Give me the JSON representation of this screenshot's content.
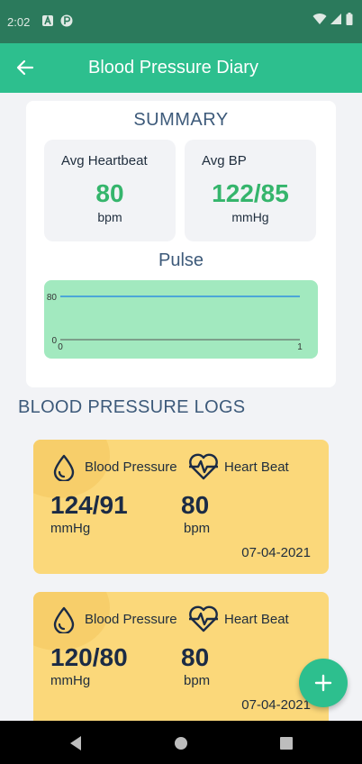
{
  "status_bar": {
    "time": "2:02"
  },
  "app_bar": {
    "title": "Blood Pressure Diary"
  },
  "summary": {
    "heading": "SUMMARY",
    "avg_heartbeat": {
      "label": "Avg Heartbeat",
      "value": "80",
      "unit": "bpm"
    },
    "avg_bp": {
      "label": "Avg BP",
      "value": "122/85",
      "unit": "mmHg"
    },
    "pulse_title": "Pulse"
  },
  "chart_data": {
    "type": "line",
    "title": "Pulse",
    "x": [
      0,
      1
    ],
    "series": [
      {
        "values": [
          80,
          80
        ],
        "color": "#2f8fe0"
      }
    ],
    "xlim": [
      0,
      1
    ],
    "ylim": [
      0,
      80
    ],
    "x_ticks": [
      "0",
      "1"
    ],
    "y_ticks": [
      "0",
      "80"
    ],
    "background": "#a2e9bf"
  },
  "logs": {
    "heading": "BLOOD PRESSURE LOGS",
    "items": [
      {
        "bp_label": "Blood Pressure",
        "hb_label": "Heart Beat",
        "bp_value": "124/91",
        "bp_unit": "mmHg",
        "hb_value": "80",
        "hb_unit": "bpm",
        "date": "07-04-2021"
      },
      {
        "bp_label": "Blood Pressure",
        "hb_label": "Heart Beat",
        "bp_value": "120/80",
        "bp_unit": "mmHg",
        "hb_value": "80",
        "hb_unit": "bpm",
        "date": "07-04-2021"
      }
    ]
  },
  "colors": {
    "primary": "#2dbf8e",
    "status_bar": "#2b7a5c",
    "card_yellow": "#fbd87a",
    "stat_green": "#35b56c",
    "heading_blue": "#3d5a7a"
  },
  "icons": {
    "back": "arrow-left-icon",
    "blood_drop": "blood-drop-icon",
    "heartbeat": "heartbeat-icon",
    "add": "plus-icon"
  }
}
